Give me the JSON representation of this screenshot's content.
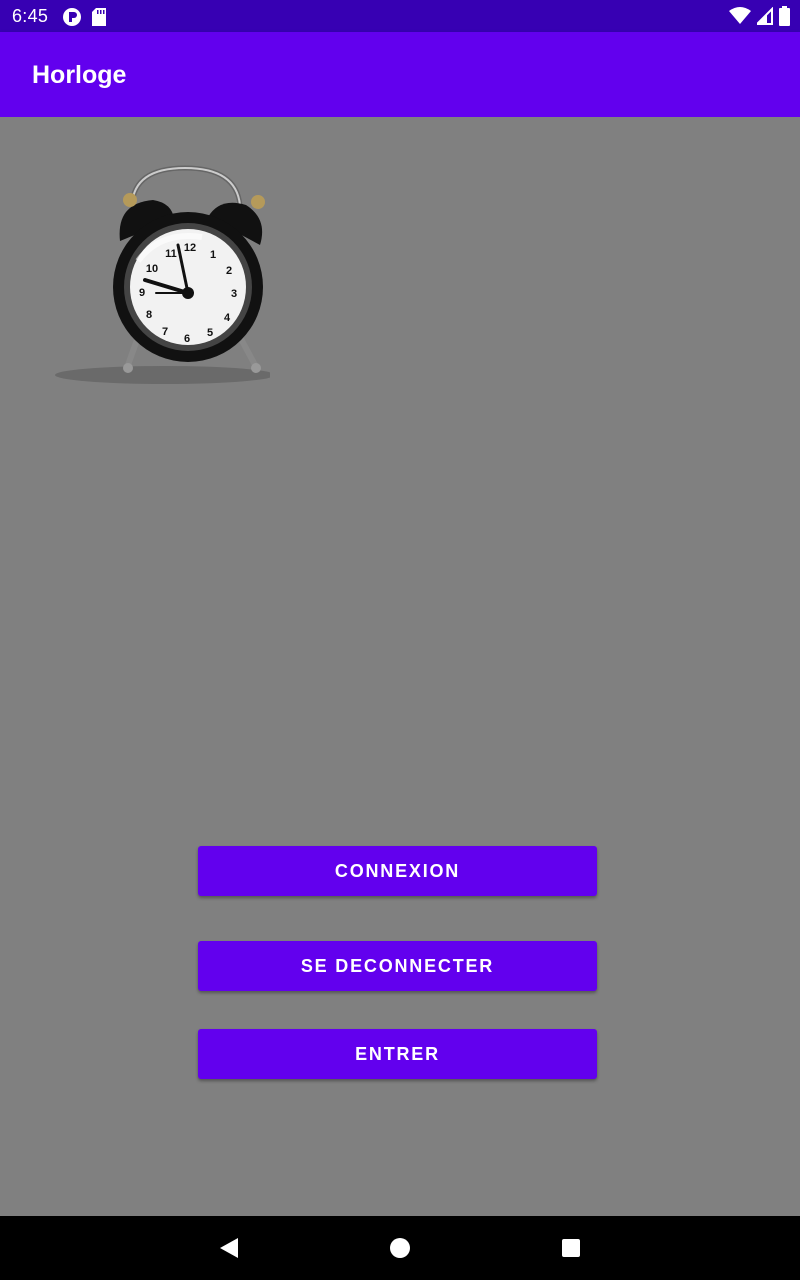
{
  "status_bar": {
    "time": "6:45",
    "left_icons": [
      "notification-app-icon",
      "sd-card-icon"
    ],
    "right_icons": [
      "wifi-icon",
      "cell-signal-icon",
      "battery-icon"
    ]
  },
  "app_bar": {
    "title": "Horloge",
    "color": "#6200ee"
  },
  "main": {
    "image": "alarm-clock-image",
    "buttons": [
      {
        "label": "CONNEXION"
      },
      {
        "label": "SE DECONNECTER"
      },
      {
        "label": "ENTRER"
      }
    ]
  },
  "nav_bar": {
    "buttons": [
      "back-icon",
      "home-icon",
      "recents-icon"
    ]
  },
  "colors": {
    "status_bar": "#3700b3",
    "primary": "#6200ee",
    "background": "#808080"
  }
}
